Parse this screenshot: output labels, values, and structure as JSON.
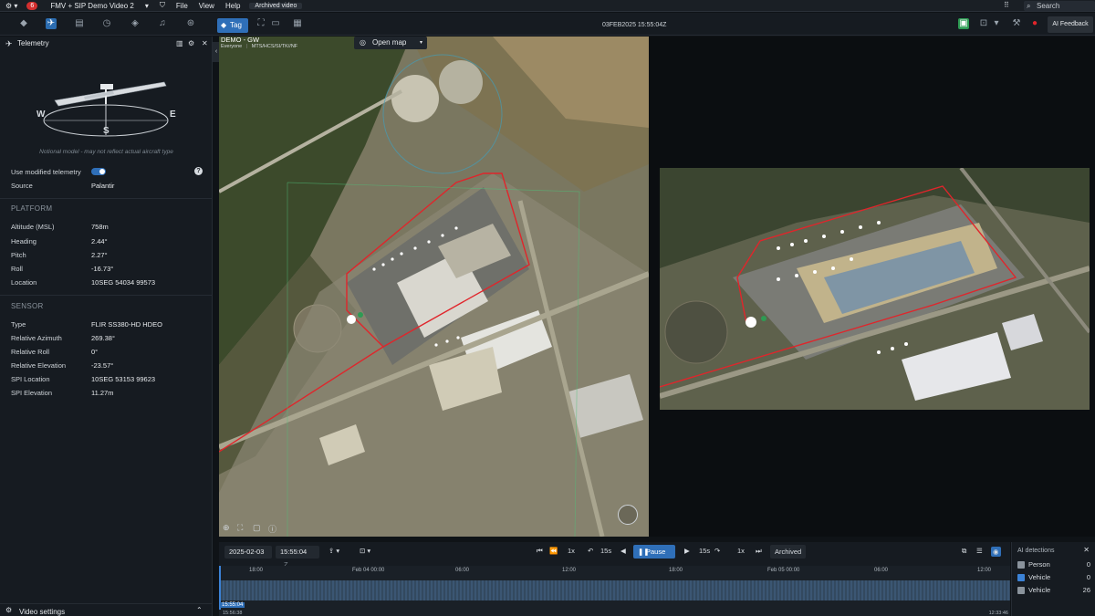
{
  "topbar": {
    "alert_count": "6",
    "app_title": "FMV + SIP Demo Video 2",
    "menu": [
      "File",
      "View",
      "Help"
    ],
    "archived_badge": "Archived video",
    "search_placeholder": "Search"
  },
  "toolbar": {
    "tag_label": "Tag",
    "timestamp": "03FEB2025 15:55:04Z",
    "ai_feedback": "AI Feedback"
  },
  "video_overlay": {
    "title": "DEMO - GW",
    "meta_left": "Everyone",
    "meta_right": "MTS/HCS/SI/TK//NF",
    "open_map": "Open map"
  },
  "telemetry": {
    "panel_title": "Telemetry",
    "compass": {
      "west": "W",
      "east": "E",
      "south": "S"
    },
    "model_note": "Notional model - may not reflect actual aircraft type",
    "use_modified_label": "Use modified telemetry",
    "source_label": "Source",
    "source_value": "Palantir",
    "platform_title": "PLATFORM",
    "platform": [
      {
        "label": "Altitude (MSL)",
        "value": "758m"
      },
      {
        "label": "Heading",
        "value": "2.44°"
      },
      {
        "label": "Pitch",
        "value": "2.27°"
      },
      {
        "label": "Roll",
        "value": "-16.73°"
      },
      {
        "label": "Location",
        "value": "10SEG 54034 99573"
      }
    ],
    "sensor_title": "SENSOR",
    "sensor": [
      {
        "label": "Type",
        "value": "FLIR SS380-HD HDEO"
      },
      {
        "label": "Relative Azimuth",
        "value": "269.38°"
      },
      {
        "label": "Relative Roll",
        "value": "0°"
      },
      {
        "label": "Relative Elevation",
        "value": "-23.57°"
      },
      {
        "label": "SPI Location",
        "value": "10SEG 53153 99623"
      },
      {
        "label": "SPI Elevation",
        "value": "11.27m"
      }
    ],
    "video_settings": "Video settings"
  },
  "playback": {
    "date": "2025-02-03",
    "time": "15:55:04",
    "time_zone": "Z",
    "speed_left": "1x",
    "skip_back": "15s",
    "pause_label": "Pause",
    "skip_fwd": "15s",
    "speed_right": "1x",
    "archived": "Archived"
  },
  "timeline": {
    "ticks": [
      {
        "label": "18:00",
        "pos": 0.05
      },
      {
        "label": "Feb 04 00:00",
        "pos": 0.18
      },
      {
        "label": "06:00",
        "pos": 0.31
      },
      {
        "label": "12:00",
        "pos": 0.445
      },
      {
        "label": "18:00",
        "pos": 0.58
      },
      {
        "label": "Feb 05 00:00",
        "pos": 0.705
      },
      {
        "label": "06:00",
        "pos": 0.84
      },
      {
        "label": "12:00",
        "pos": 0.97
      }
    ],
    "cursor_label": "15:55:04",
    "start_label": "15:56:38",
    "end_label": "12:33:46"
  },
  "ai_detections": {
    "title": "AI detections",
    "items": [
      {
        "label": "Person",
        "count": "0",
        "color": "#8a939c"
      },
      {
        "label": "Vehicle",
        "count": "0",
        "color": "#3b82d6"
      },
      {
        "label": "Vehicle",
        "count": "26",
        "color": "#8a939c"
      }
    ]
  },
  "colors": {
    "accent": "#2f6fb8",
    "geofence": "#e0252b",
    "alert": "#d32f2f"
  }
}
